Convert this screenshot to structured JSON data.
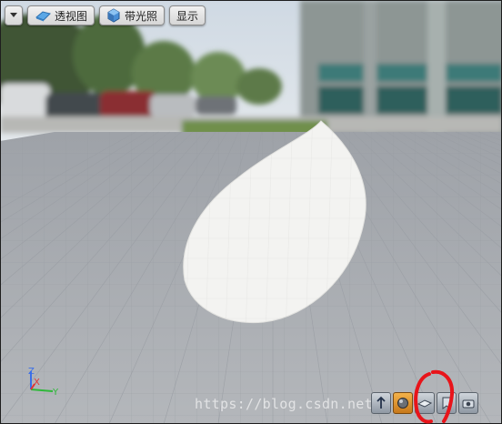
{
  "toolbar": {
    "dropdown_icon": "caret-down-icon",
    "perspective_label": "透视图",
    "perspective_icon": "perspective-cube-icon",
    "lit_label": "带光照",
    "lit_icon": "lit-sphere-icon",
    "show_label": "显示"
  },
  "axis": {
    "z": "Z",
    "x": "X",
    "y": "Y"
  },
  "watermark": "https://blog.csdn.net/",
  "mode_buttons": [
    {
      "icon": "move-tool-icon",
      "active": false
    },
    {
      "icon": "sphere-mode-icon",
      "active": true
    },
    {
      "icon": "flat-sheet-icon",
      "active": false
    },
    {
      "icon": "bookmark-icon",
      "active": false
    },
    {
      "icon": "camera-icon",
      "active": false
    }
  ],
  "colors": {
    "floor": "#a8abb0",
    "leaf": "#f3f3f1",
    "sky": "#d9e2ea",
    "annotation": "#e8141a",
    "active_mode": "#e59a2a"
  }
}
